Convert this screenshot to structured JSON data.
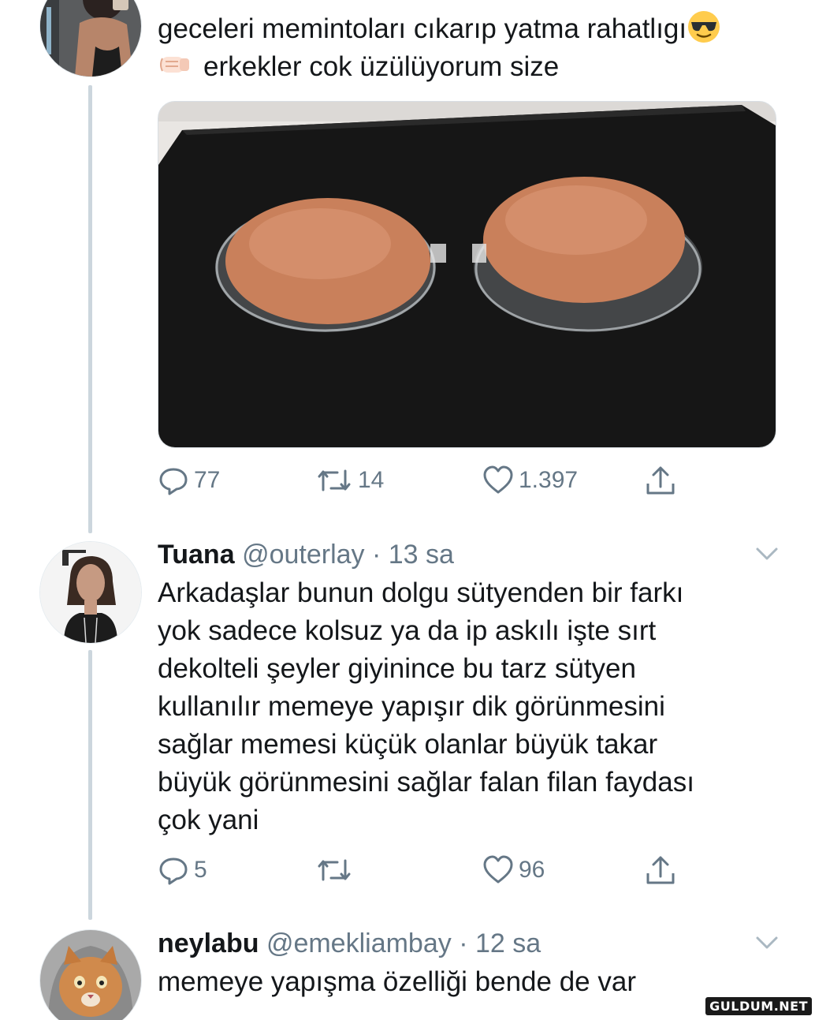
{
  "tweets": [
    {
      "text_line1": "geceleri memintoları cıkarıp yatma rahatlıgı",
      "text_line2": "erkekler cok üzülüyorum size",
      "emoji1": "sunglasses-face-emoji",
      "emoji2": "left-facing-fist-emoji",
      "media_icon": "silicone-bra-photo",
      "replies": "77",
      "retweets": "14",
      "likes": "1.397"
    },
    {
      "name": "Tuana",
      "handle": "@outerlay",
      "time": "· 13 sa",
      "text": "Arkadaşlar bunun dolgu sütyenden bir farkı\nyok sadece kolsuz ya da ip askılı işte sırt\ndekolteli şeyler giyinince bu tarz sütyen\nkullanılır memeye yapışır dik görünmesini\nsağlar memesi küçük olanlar büyük takar\nbüyük görünmesini sağlar falan filan faydası\nçok yani",
      "replies": "5",
      "retweets": "",
      "likes": "96"
    },
    {
      "name": "neylabu",
      "handle": "@emekliambay",
      "time": "· 12 sa",
      "text": "memeye yapışma özelliği bende de var"
    }
  ],
  "icons": {
    "reply": "reply-icon",
    "retweet": "retweet-icon",
    "like": "heart-icon",
    "share": "share-icon",
    "caret": "chevron-down-icon"
  },
  "colors": {
    "text": "#14171a",
    "secondary": "#657786",
    "thread_line": "#ccd6dd"
  },
  "watermark": "GULDUM.NET"
}
